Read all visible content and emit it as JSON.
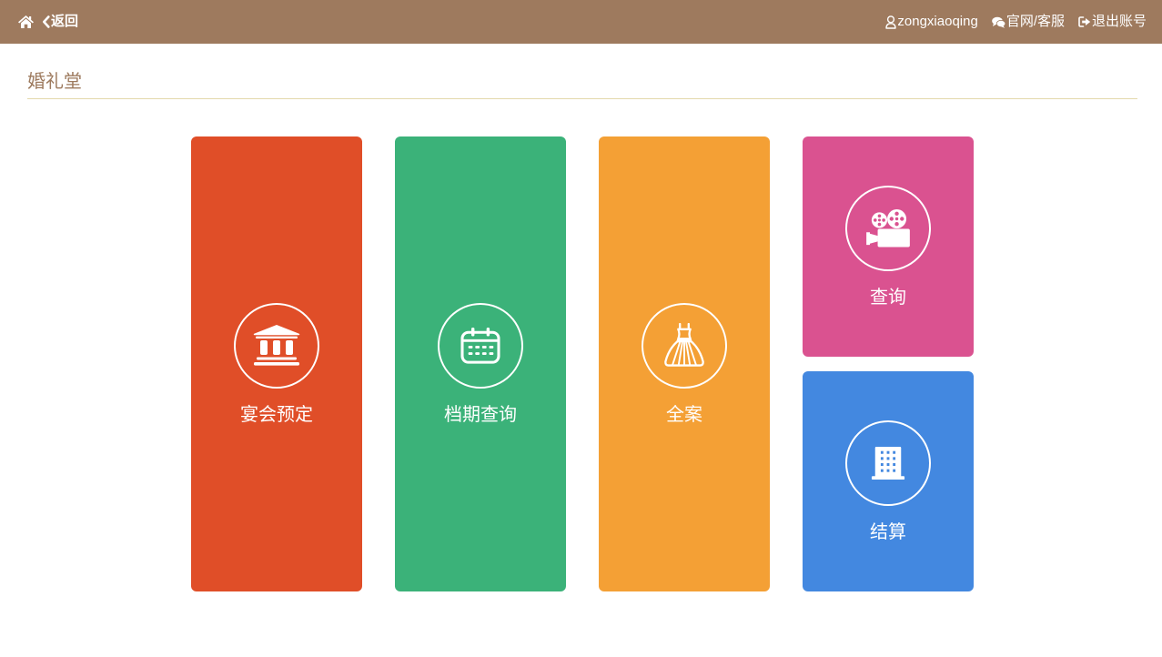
{
  "header": {
    "bg_color": "#9E7A5E",
    "home_icon": "home-icon",
    "back_icon": "chevron-left-icon",
    "back_label": "返回",
    "user_icon": "user-icon",
    "user_name": "zongxiaoqing",
    "service_icon": "comments-icon",
    "service_label": "官网/客服",
    "logout_icon": "sign-out-icon",
    "logout_label": "退出账号"
  },
  "page": {
    "title": "婚礼堂",
    "title_color": "#9D7A5E"
  },
  "tiles": [
    {
      "label": "宴会预定",
      "icon": "bank-icon",
      "color": "#E04E28"
    },
    {
      "label": "档期查询",
      "icon": "calendar-icon",
      "color": "#3BB279"
    },
    {
      "label": "全案",
      "icon": "wedding-dress-icon",
      "color": "#F4A035"
    },
    {
      "label": "查询",
      "icon": "film-camera-icon",
      "color": "#DA5290"
    },
    {
      "label": "结算",
      "icon": "building-icon",
      "color": "#4388E0"
    }
  ]
}
